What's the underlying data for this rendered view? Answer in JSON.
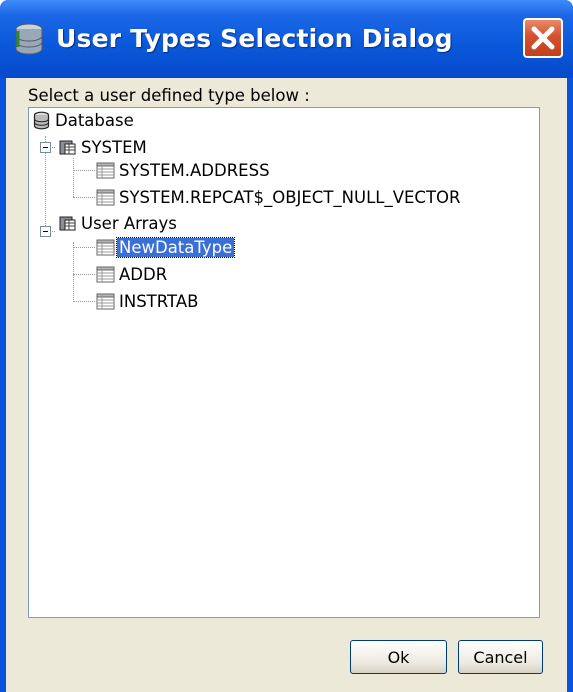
{
  "window": {
    "title": "User Types Selection Dialog",
    "icon": "database-icon",
    "accent_color": "#0a54dc",
    "close_icon": "close-icon"
  },
  "dialog": {
    "prompt": "Select a user defined type below :",
    "tree": {
      "root": {
        "label": "Database",
        "icon": "database-icon"
      },
      "groups": [
        {
          "label": "SYSTEM",
          "icon": "schema-icon",
          "expanded": true,
          "children": [
            {
              "label": "SYSTEM.ADDRESS",
              "icon": "table-icon"
            },
            {
              "label": "SYSTEM.REPCAT$_OBJECT_NULL_VECTOR",
              "icon": "table-icon"
            }
          ]
        },
        {
          "label": "User Arrays",
          "icon": "schema-icon",
          "expanded": true,
          "children": [
            {
              "label": "NewDataType",
              "icon": "table-icon",
              "selected": true
            },
            {
              "label": "ADDR",
              "icon": "table-icon"
            },
            {
              "label": "INSTRTAB",
              "icon": "table-icon"
            }
          ]
        }
      ]
    },
    "buttons": {
      "ok": "Ok",
      "cancel": "Cancel"
    }
  }
}
